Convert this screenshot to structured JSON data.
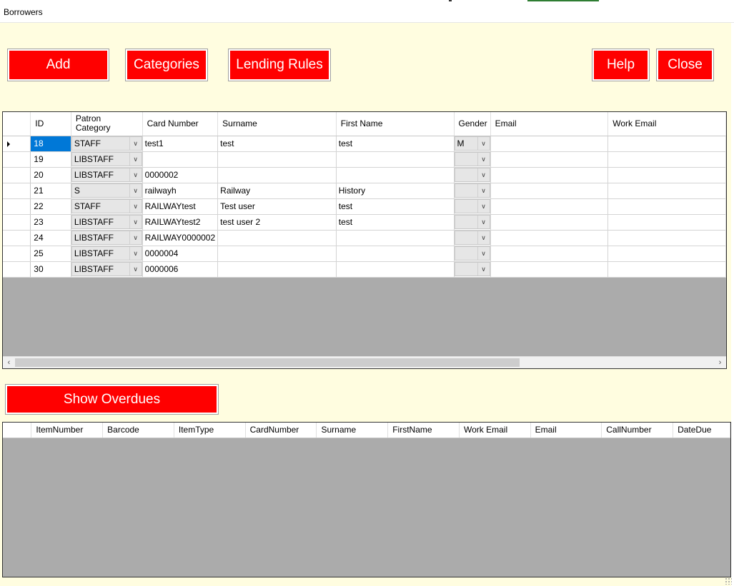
{
  "window": {
    "title": "Borrowers"
  },
  "toolbar": {
    "add_label": "Add",
    "categories_label": "Categories",
    "lending_rules_label": "Lending Rules",
    "help_label": "Help",
    "close_label": "Close",
    "show_overdues_label": "Show Overdues"
  },
  "borrowers_grid": {
    "columns": [
      "ID",
      "Patron Category",
      "Card Number",
      "Surname",
      "First Name",
      "Gender",
      "Email",
      "Work Email"
    ],
    "rows": [
      [
        "18",
        "STAFF",
        "test1",
        "test",
        "test",
        "M",
        "",
        ""
      ],
      [
        "19",
        "LIBSTAFF",
        "",
        "",
        "",
        "",
        "",
        ""
      ],
      [
        "20",
        "LIBSTAFF",
        "0000002",
        "",
        "",
        "",
        "",
        ""
      ],
      [
        "21",
        "S",
        "railwayh",
        "Railway",
        "History",
        "",
        "",
        ""
      ],
      [
        "22",
        "STAFF",
        "RAILWAYtest",
        "Test user",
        "test",
        "",
        "",
        ""
      ],
      [
        "23",
        "LIBSTAFF",
        "RAILWAYtest2",
        "test user 2",
        "test",
        "",
        "",
        ""
      ],
      [
        "24",
        "LIBSTAFF",
        "RAILWAY0000002",
        "",
        "",
        "",
        "",
        ""
      ],
      [
        "25",
        "LIBSTAFF",
        "0000004",
        "",
        "",
        "",
        "",
        ""
      ],
      [
        "30",
        "LIBSTAFF",
        "0000006",
        "",
        "",
        "",
        "",
        ""
      ]
    ],
    "scroll_left_glyph": "‹",
    "scroll_right_glyph": "›"
  },
  "overdues_grid": {
    "columns": [
      "ItemNumber",
      "Barcode",
      "ItemType",
      "CardNumber",
      "Surname",
      "FirstName",
      "Work Email",
      "Email",
      "CallNumber",
      "DateDue"
    ]
  },
  "colors": {
    "button_red": "#ff0000",
    "form_background": "#fffde0",
    "selection_blue": "#0078d7",
    "grid_empty": "#ababab"
  }
}
